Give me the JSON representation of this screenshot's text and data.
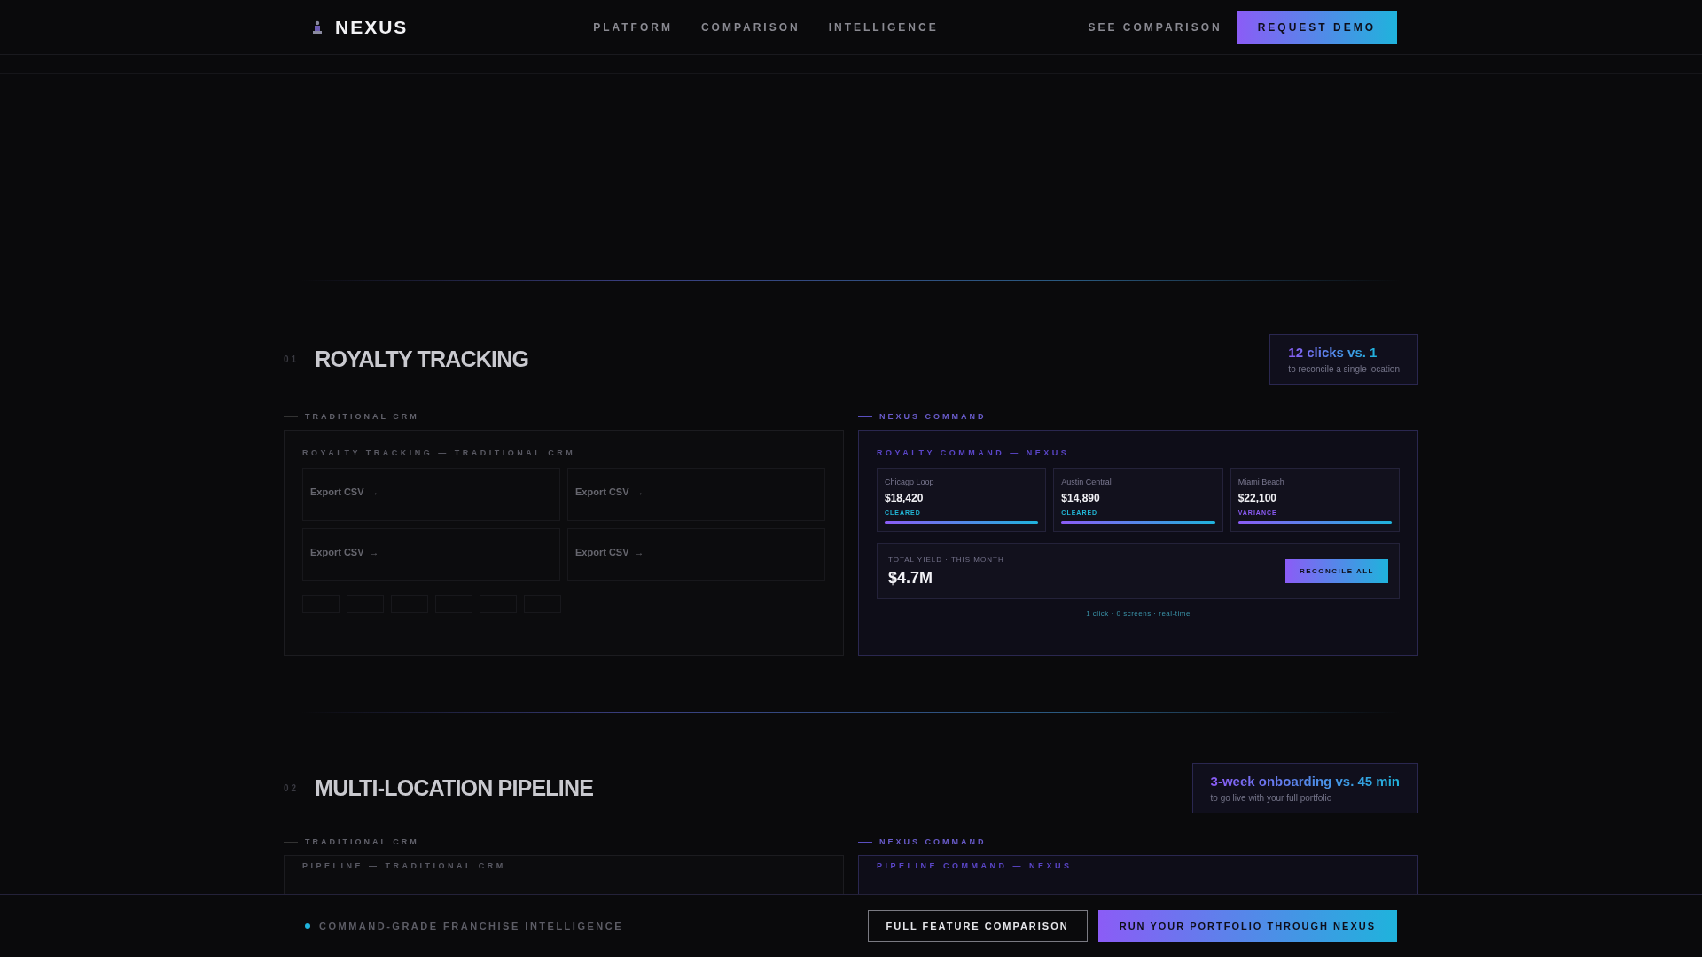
{
  "nav": {
    "brand": "NEXUS",
    "links": [
      "PLATFORM",
      "COMPARISON",
      "INTELLIGENCE"
    ],
    "secondary": "SEE COMPARISON",
    "cta": "REQUEST DEMO"
  },
  "sections": [
    {
      "number": "01",
      "title": "ROYALTY TRACKING",
      "badge": {
        "headline": "12 clicks vs. 1",
        "caption": "to reconcile a single location"
      },
      "traditional": {
        "label": "TRADITIONAL CRM",
        "panel_title": "ROYALTY TRACKING — TRADITIONAL CRM",
        "cards": [
          {
            "action": "Export CSV",
            "arrow": "→"
          },
          {
            "action": "Export CSV",
            "arrow": "→"
          },
          {
            "action": "Export CSV",
            "arrow": "→"
          },
          {
            "action": "Export CSV",
            "arrow": "→"
          }
        ]
      },
      "nexus": {
        "label": "NEXUS COMMAND",
        "panel_title": "ROYALTY COMMAND — NEXUS",
        "locations": [
          {
            "name": "Chicago Loop",
            "amount": "$18,420",
            "status": "CLEARED",
            "color": "#22b8d8",
            "level": 1
          },
          {
            "name": "Austin Central",
            "amount": "$14,890",
            "status": "CLEARED",
            "color": "#22b8d8",
            "level": 1
          },
          {
            "name": "Miami Beach",
            "amount": "$22,100",
            "status": "VARIANCE",
            "color": "#8b5cf6",
            "level": 1
          }
        ],
        "total": {
          "label": "TOTAL YIELD · THIS MONTH",
          "value": "$4.7M",
          "button": "RECONCILE ALL"
        },
        "footnote": "1 click · 0 screens · real-time"
      }
    },
    {
      "number": "02",
      "title": "MULTI-LOCATION PIPELINE",
      "badge": {
        "headline": "3-week onboarding vs. 45 min",
        "caption": "to go live with your full portfolio"
      },
      "traditional": {
        "label": "TRADITIONAL CRM",
        "panel_title": "PIPELINE — TRADITIONAL CRM"
      },
      "nexus": {
        "label": "NEXUS COMMAND",
        "panel_title": "PIPELINE COMMAND — NEXUS"
      }
    }
  ],
  "footer": {
    "tagline": "COMMAND-GRADE FRANCHISE INTELLIGENCE",
    "secondary": "FULL FEATURE COMPARISON",
    "cta": "RUN YOUR PORTFOLIO THROUGH NEXUS"
  }
}
